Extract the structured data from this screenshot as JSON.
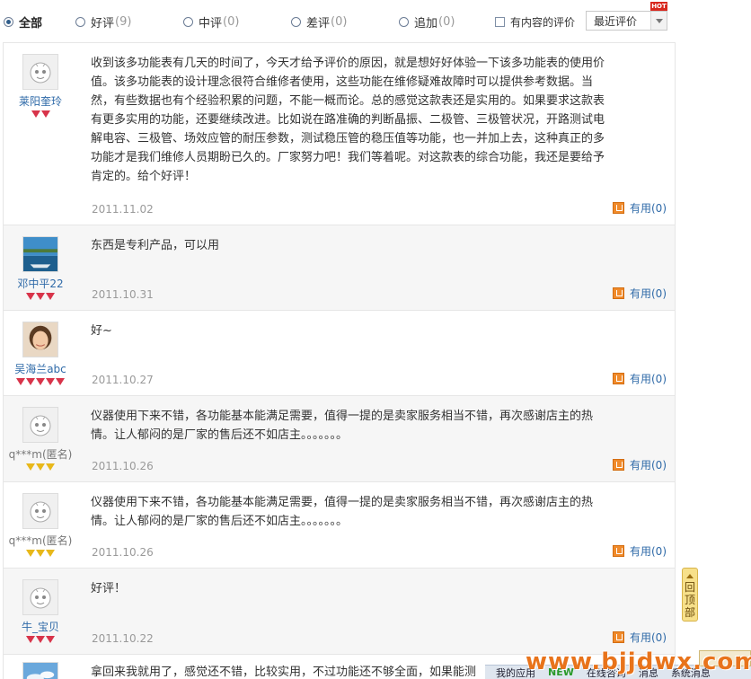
{
  "filters": {
    "options": [
      {
        "label": "全部",
        "count": "",
        "checked": true
      },
      {
        "label": "好评",
        "count": "(9)",
        "checked": false
      },
      {
        "label": "中评",
        "count": "(0)",
        "checked": false
      },
      {
        "label": "差评",
        "count": "(0)",
        "checked": false
      },
      {
        "label": "追加",
        "count": "(0)",
        "checked": false
      }
    ],
    "content_only_label": "有内容的评价",
    "sort_value": "最近评价",
    "hot_badge": "HOT"
  },
  "reviews": [
    {
      "user": "莱阳奎玲",
      "avatar": "default-avatar-icon",
      "gems": 2,
      "gem_color": "red",
      "text": "收到该多功能表有几天的时间了，今天才给予评价的原因，就是想好好体验一下该多功能表的使用价值。该多功能表的设计理念很符合维修者使用，这些功能在维修疑难故障时可以提供参考数据。当然，有些数据也有个经验积累的问题，不能一概而论。总的感觉这款表还是实用的。如果要求这款表有更多实用的功能，还要继续改进。比如说在路准确的判断晶振、二极管、三极管状况，开路测试电解电容、三极管、场效应管的耐压参数，测试稳压管的稳压值等功能，也一并加上去，这种真正的多功能才是我们维修人员期盼已久的。厂家努力吧！我们等着呢。对这款表的综合功能，我还是要给予肯定的。给个好评！",
      "date": "2011.11.02",
      "useful": "有用(0)"
    },
    {
      "user": "邓中平22",
      "avatar": "boat-photo-avatar",
      "gems": 3,
      "gem_color": "red",
      "text": "东西是专利产品，可以用",
      "date": "2011.10.31",
      "useful": "有用(0)"
    },
    {
      "user": "吴海兰abc",
      "avatar": "woman-photo-avatar",
      "gems": 5,
      "gem_color": "red",
      "text": "好~",
      "date": "2011.10.27",
      "useful": "有用(0)"
    },
    {
      "user": "q***m(匿名)",
      "avatar": "default-avatar-icon",
      "gems": 3,
      "gem_color": "gold",
      "text": "仪器使用下来不错，各功能基本能满足需要，值得一提的是卖家服务相当不错，再次感谢店主的热情。让人郁闷的是厂家的售后还不如店主。。。。。。。",
      "date": "2011.10.26",
      "useful": "有用(0)"
    },
    {
      "user": "q***m(匿名)",
      "avatar": "default-avatar-icon",
      "gems": 3,
      "gem_color": "gold",
      "text": "仪器使用下来不错，各功能基本能满足需要，值得一提的是卖家服务相当不错，再次感谢店主的热情。让人郁闷的是厂家的售后还不如店主。。。。。。。",
      "date": "2011.10.26",
      "useful": "有用(0)"
    },
    {
      "user": "牛_宝贝",
      "avatar": "default-avatar-icon",
      "gems": 3,
      "gem_color": "red",
      "text": "好评！",
      "date": "2011.10.22",
      "useful": "有用(0)"
    },
    {
      "user": "",
      "avatar": "sky-photo-avatar",
      "gems": 0,
      "gem_color": "red",
      "text": "拿回来我就用了，感觉还不错，比较实用，不过功能还不够全面，如果能测",
      "date": "",
      "useful": ""
    }
  ],
  "back_to_top": "回顶部",
  "watermark": "www.bjjdwx.com",
  "taskbar": {
    "items": [
      "我的应用",
      "NEW",
      "在线咨询",
      "消息",
      "系统消息"
    ]
  }
}
